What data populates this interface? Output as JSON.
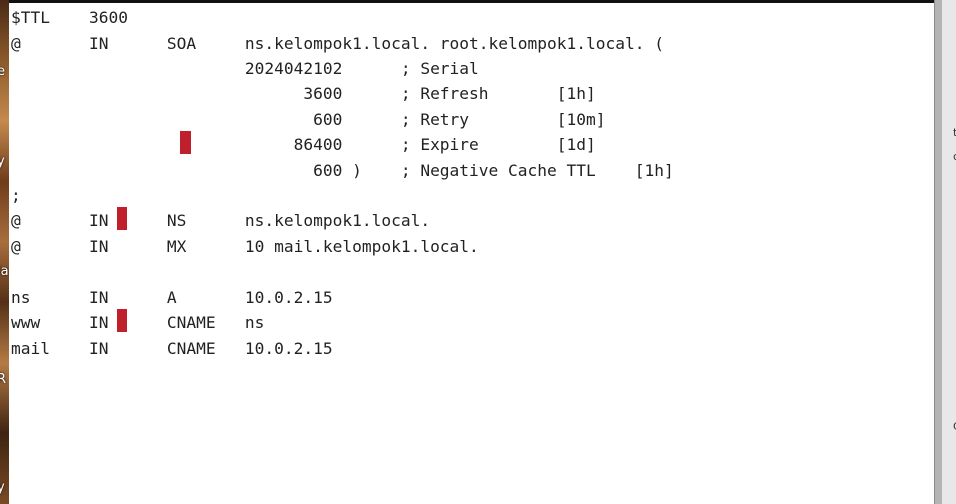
{
  "zone_file": {
    "lines": [
      "$TTL    3600",
      "@       IN      SOA     ns.kelompok1.local. root.kelompok1.local. (",
      "                        2024042102      ; Serial",
      "                              3600      ; Refresh       [1h]",
      "                               600      ; Retry         [10m]",
      "                             86400      ; Expire        [1d]",
      "                               600 )    ; Negative Cache TTL    [1h]",
      ";",
      "@       IN      NS      ns.kelompok1.local.",
      "@       IN      MX      10 mail.kelompok1.local.",
      "",
      "ns      IN      A       10.0.2.15",
      "www     IN      CNAME   ns",
      "mail    IN      CNAME   10.0.2.15"
    ]
  },
  "desktop_strip": {
    "fragments": [
      "e",
      "y",
      "la",
      "R",
      "y"
    ]
  },
  "right_panel": {
    "fragments": [
      "t",
      "c",
      "C"
    ]
  },
  "colors": {
    "terminal_background": "#ffffff",
    "text": "#222222",
    "cursor_marker": "#c0202b",
    "top_rule": "#111111"
  }
}
